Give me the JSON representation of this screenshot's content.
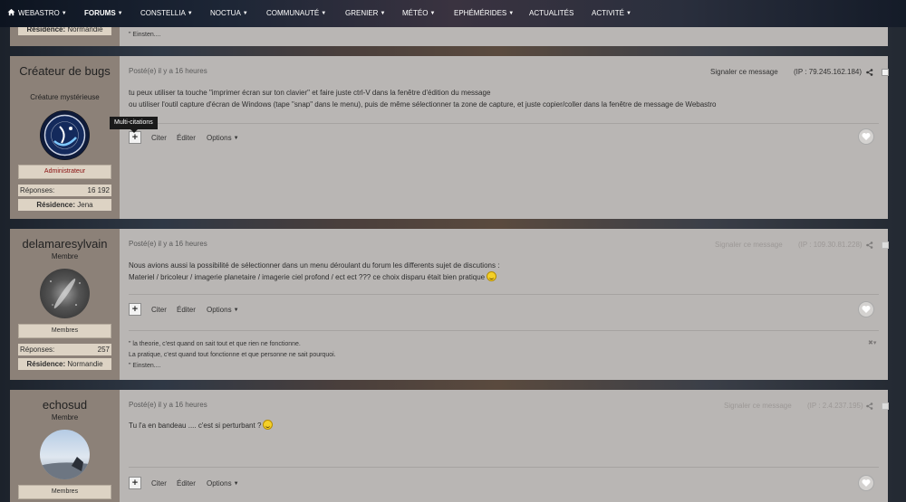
{
  "nav": {
    "items": [
      {
        "label": "WEBASTRO",
        "icon": "home-icon"
      },
      {
        "label": "FORUMS"
      },
      {
        "label": "CONSTELLIA"
      },
      {
        "label": "NOCTUA"
      },
      {
        "label": "COMMUNAUTÉ"
      },
      {
        "label": "GRENIER"
      },
      {
        "label": "MÉTÉO"
      },
      {
        "label": "EPHÉMÉRIDES"
      },
      {
        "label": "ACTUALITÉS"
      },
      {
        "label": "ACTIVITÉ"
      }
    ]
  },
  "prev_post": {
    "residence_label": "Résidence:",
    "residence": "Normandie",
    "signature_end": "\" Einsten...."
  },
  "posts": [
    {
      "author": "Créateur de bugs",
      "title": "Créature mystérieuse",
      "role": "Administrateur",
      "stats_label": "Réponses:",
      "stats_value": "16 192",
      "residence_label": "Résidence:",
      "residence": "Jena",
      "posted": "Posté(e) il y a 16 heures",
      "report": "Signaler ce message",
      "ip": "(IP : 79.245.162.184)",
      "content": [
        "tu peux utiliser ta touche \"imprimer écran sur ton clavier\" et faire juste ctrl-V dans la fenêtre d'édition du message",
        "ou utiliser l'outil capture d'écran de Windows (tape \"snap\" dans le menu), puis de même sélectionner ta zone de capture, et juste copier/coller dans la fenêtre de message de Webastro"
      ],
      "actions": {
        "quote": "Citer",
        "edit": "Éditer",
        "options": "Options"
      }
    },
    {
      "author": "delamaresylvain",
      "title": "Membre",
      "role": "Membres",
      "stats_label": "Réponses:",
      "stats_value": "257",
      "residence_label": "Résidence:",
      "residence": "Normandie",
      "posted": "Posté(e) il y a 16 heures",
      "report": "Signaler ce message",
      "ip": "(IP : 109.30.81.228)",
      "content": [
        "Nous avions aussi la possibilité de sélectionner dans un menu déroulant du forum les differents sujet de discutions :",
        "Materiel / bricoleur / imagerie planetaire / imagerie ciel profond /  ect ect ??? ce choix disparu était bien pratique"
      ],
      "actions": {
        "quote": "Citer",
        "edit": "Éditer",
        "options": "Options"
      },
      "signature": [
        "\" la theorie, c'est quand on sait tout et que rien ne fonctionne.",
        "La pratique, c'est quand tout fonctionne et que personne ne sait pourquoi.",
        "\" Einsten...."
      ]
    },
    {
      "author": "echosud",
      "title": "Membre",
      "role": "Membres",
      "posted": "Posté(e) il y a 16 heures",
      "report": "Signaler ce message",
      "ip": "(IP : 2.4.237.195)",
      "content": [
        "Tu l'a en bandeau .... c'est si perturbant ?"
      ],
      "actions": {
        "quote": "Citer",
        "edit": "Éditer",
        "options": "Options"
      }
    }
  ],
  "tooltip": "Multi-citations",
  "colors": {
    "post_body": "#b9b6b4",
    "author_panel": "#8c8178",
    "admin_role": "#8a1010"
  }
}
